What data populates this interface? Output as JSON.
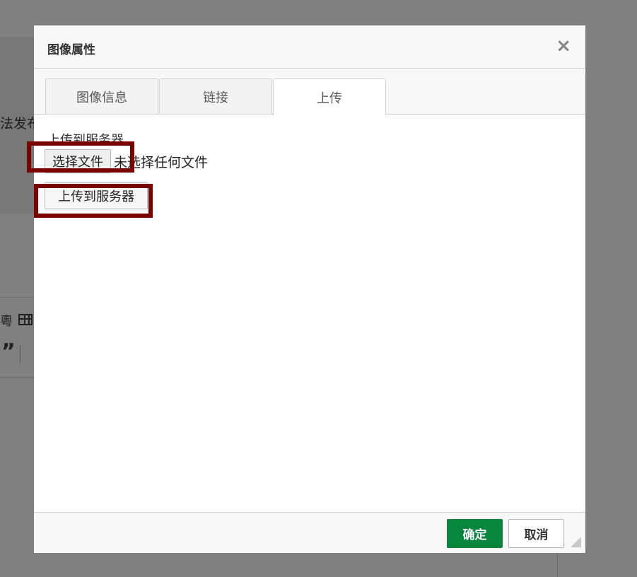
{
  "background": {
    "editor_text": "法发布",
    "toolbar_glyph": "粵",
    "quote_glyph": "”"
  },
  "dialog": {
    "title": "图像属性",
    "close_icon": "×",
    "tabs": [
      {
        "label": "图像信息",
        "active": false
      },
      {
        "label": "链接",
        "active": false
      },
      {
        "label": "上传",
        "active": true
      }
    ],
    "upload": {
      "section_label": "上传到服务器",
      "choose_file_label": "选择文件",
      "file_status": "未选择任何文件",
      "send_button_label": "上传到服务器"
    },
    "footer": {
      "ok_label": "确定",
      "cancel_label": "取消"
    }
  },
  "colors": {
    "overlay": "#808080",
    "ok_button": "#09863e",
    "highlight": "#7a0000"
  }
}
